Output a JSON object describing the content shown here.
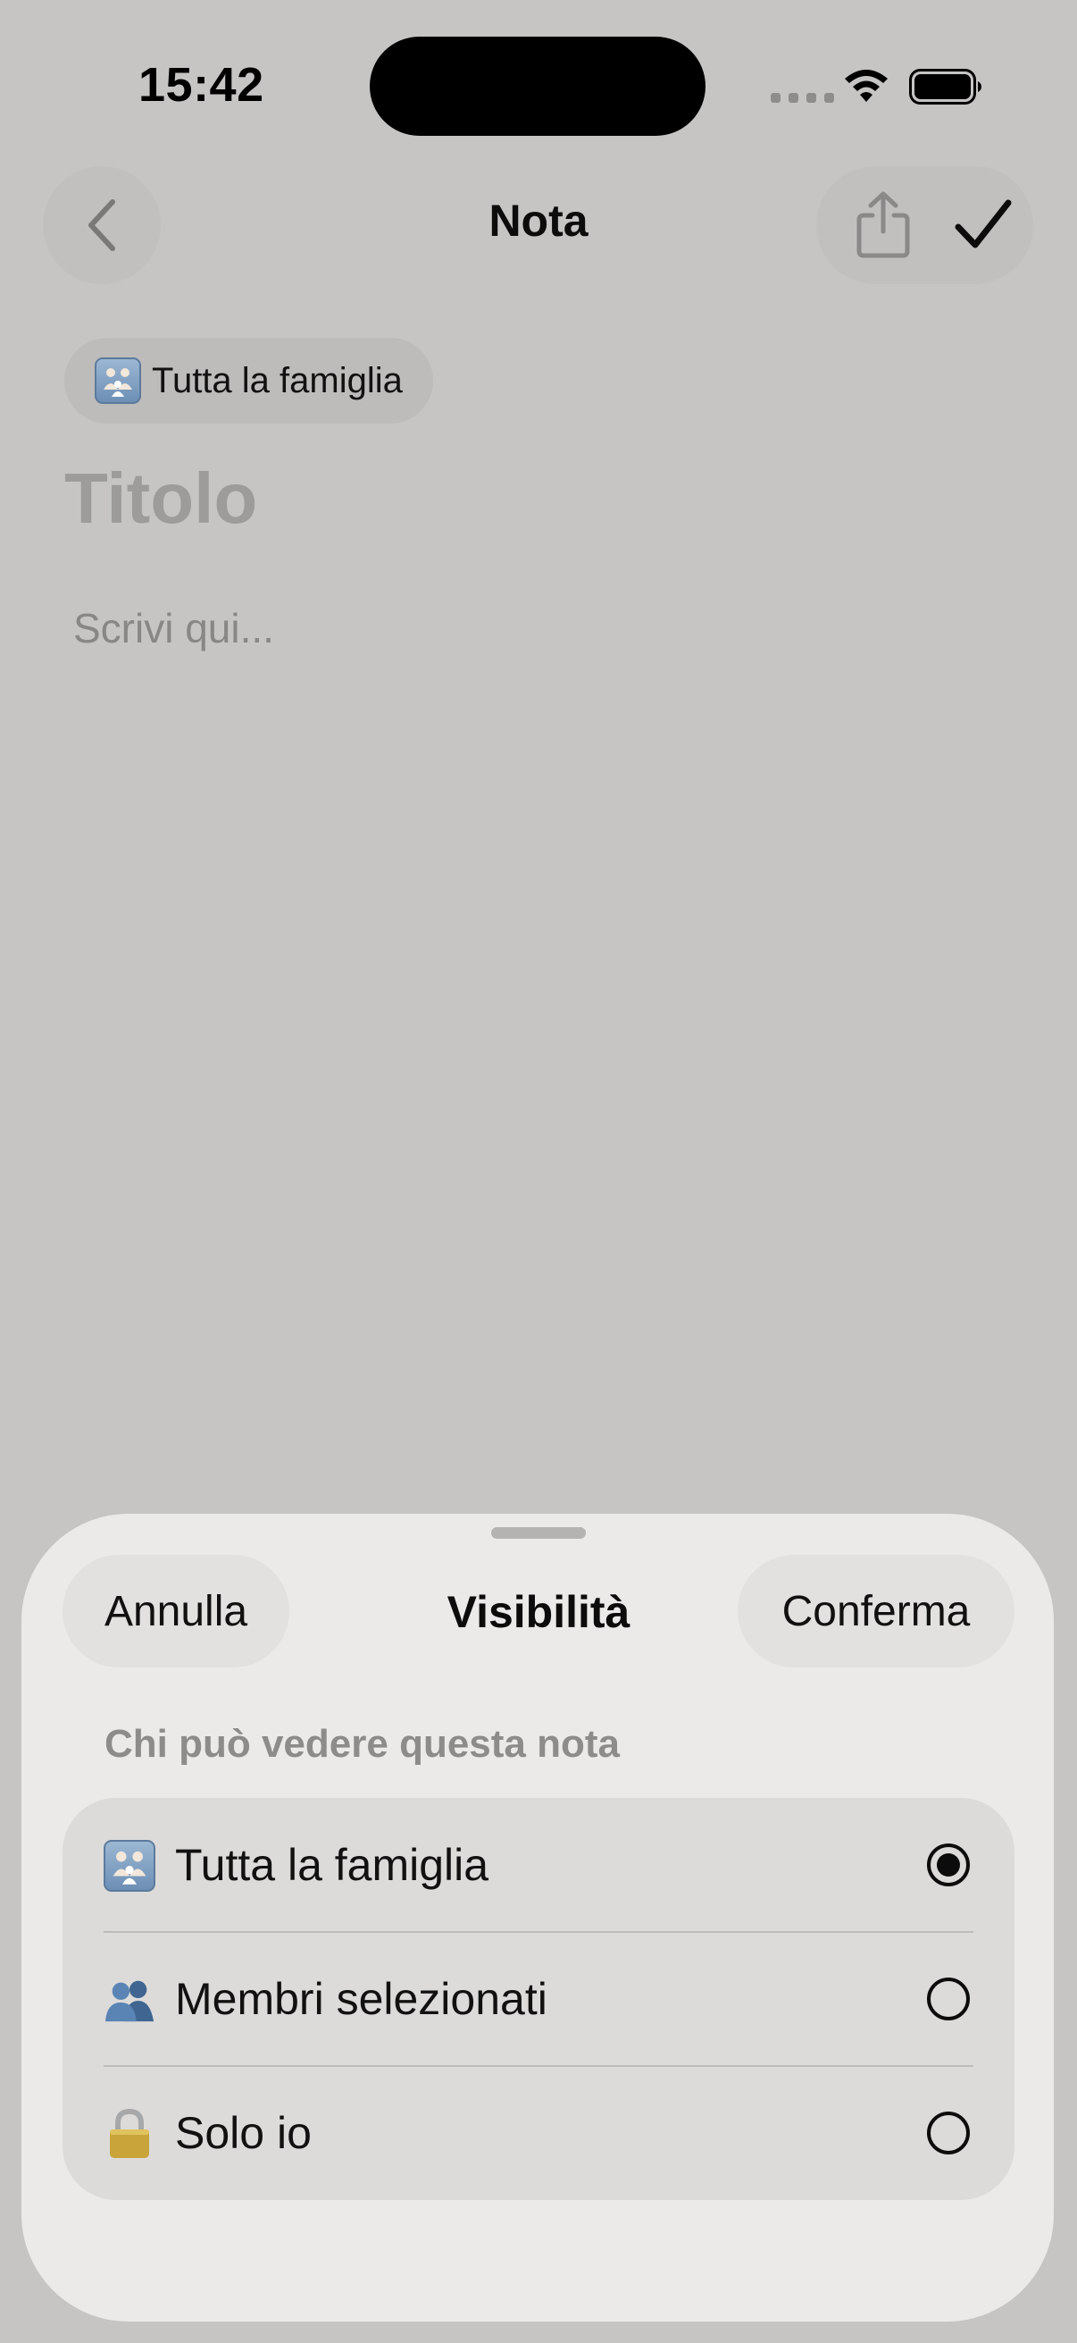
{
  "status_bar": {
    "time": "15:42",
    "icons": [
      "cellular-dots-icon",
      "wifi-icon",
      "battery-icon"
    ]
  },
  "nav": {
    "title": "Nota",
    "icons": [
      "chevron-left-icon",
      "share-icon",
      "checkmark-icon"
    ]
  },
  "note": {
    "visibility_chip": "Tutta la famiglia",
    "title_placeholder": "Titolo",
    "body_placeholder": "Scrivi qui..."
  },
  "sheet": {
    "cancel_label": "Annulla",
    "title": "Visibilità",
    "confirm_label": "Conferma",
    "section_label": "Chi può vedere questa nota",
    "options": [
      {
        "label": "Tutta la famiglia",
        "icon": "family-emoji-icon",
        "selected": true
      },
      {
        "label": "Membri selezionati",
        "icon": "people-emoji-icon",
        "selected": false
      },
      {
        "label": "Solo io",
        "icon": "lock-emoji-icon",
        "selected": false
      }
    ]
  },
  "colors": {
    "background_dim": "#c6c5c4",
    "sheet_background": "#ebeae9",
    "options_background": "#dcdbda",
    "placeholder_text": "#9d9c9b"
  }
}
